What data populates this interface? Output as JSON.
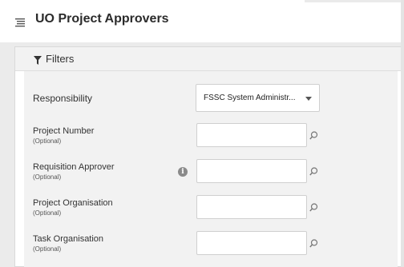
{
  "header": {
    "title": "UO Project Approvers",
    "menu_icon": "list-icon"
  },
  "filters": {
    "label": "Filters",
    "icon": "filter-icon"
  },
  "fields": [
    {
      "label": "Responsibility",
      "optional": "",
      "type": "select",
      "value": "FSSC System Administr..."
    },
    {
      "label": "Project Number",
      "optional": "(Optional)",
      "type": "lov",
      "value": ""
    },
    {
      "label": "Requisition Approver",
      "optional": "(Optional)",
      "type": "lov",
      "value": "",
      "info_icon": "info-icon"
    },
    {
      "label": "Project Organisation",
      "optional": "(Optional)",
      "type": "lov",
      "value": ""
    },
    {
      "label": "Task Organisation",
      "optional": "(Optional)",
      "type": "lov",
      "value": ""
    }
  ],
  "colors": {
    "background": "#eaeaea",
    "panel": "#f2f2f2",
    "text": "#333333"
  }
}
